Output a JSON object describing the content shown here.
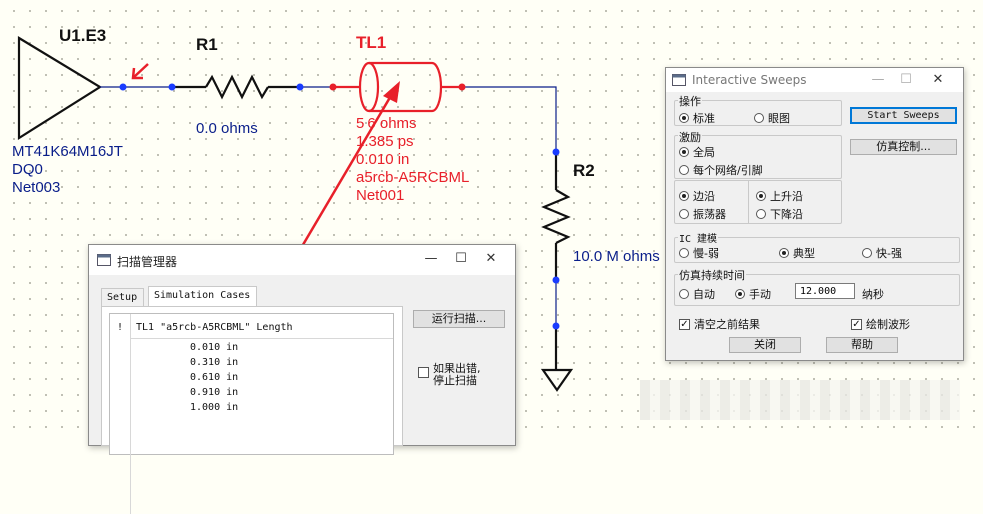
{
  "schematic": {
    "u1": {
      "ref": "U1.E3",
      "part": "MT41K64M16JT",
      "pin": "DQ0",
      "net": "Net003"
    },
    "r1": {
      "ref": "R1",
      "value": "0.0 ohms"
    },
    "tl1": {
      "ref": "TL1",
      "impedance": "5 6 ohms",
      "delay": "1.385 ps",
      "length": "0.010 in",
      "model": "a5rcb-A5RCBML",
      "net": "Net001"
    },
    "r2": {
      "ref": "R2",
      "value": "10.0 M ohms"
    },
    "colors": {
      "wire": "#0a1e8a",
      "highlight": "#e8202a",
      "symbol": "#111111",
      "node": "#1a3cff"
    }
  },
  "sweep_manager": {
    "title": "扫描管理器",
    "tabs": [
      "Setup",
      "Simulation Cases"
    ],
    "active_tab": "Simulation Cases",
    "table": {
      "col_flag": "!",
      "col_header": "TL1 \"a5rcb-A5RCBML\" Length",
      "rows": [
        "0.010 in",
        "0.310 in",
        "0.610 in",
        "0.910 in",
        "1.000 in"
      ]
    },
    "run_button": "运行扫描...",
    "stop_on_error": "如果出错,\n停止扫描",
    "stop_on_error_checked": false,
    "window_buttons": {
      "minimize": "—",
      "maximize": "☐",
      "close": "✕"
    }
  },
  "interactive_sweeps": {
    "title": "Interactive Sweeps",
    "operation": {
      "label": "操作",
      "options": [
        "标准",
        "眼图"
      ],
      "selected": "标准"
    },
    "start_button": "Start Sweeps",
    "sim_control_button": "仿真控制...",
    "stimulus": {
      "label": "激励",
      "options": [
        "全局",
        "每个网络/引脚"
      ],
      "selected": "全局"
    },
    "edge": {
      "options": [
        "边沿",
        "振荡器"
      ],
      "selected": "边沿"
    },
    "direction": {
      "options": [
        "上升沿",
        "下降沿"
      ],
      "selected": "上升沿"
    },
    "ic_model": {
      "label": "IC 建模",
      "options": [
        "慢-弱",
        "典型",
        "快-强"
      ],
      "selected": "典型"
    },
    "duration": {
      "label": "仿真持续时间",
      "options": [
        "自动",
        "手动"
      ],
      "selected": "手动",
      "value": "12.000",
      "unit": "纳秒"
    },
    "clear_results": {
      "label": "清空之前结果",
      "checked": true
    },
    "draw_waveform": {
      "label": "绘制波形",
      "checked": true
    },
    "close_button": "关闭",
    "help_button": "帮助",
    "window_buttons": {
      "minimize": "—",
      "maximize": "☐",
      "close": "✕"
    }
  }
}
